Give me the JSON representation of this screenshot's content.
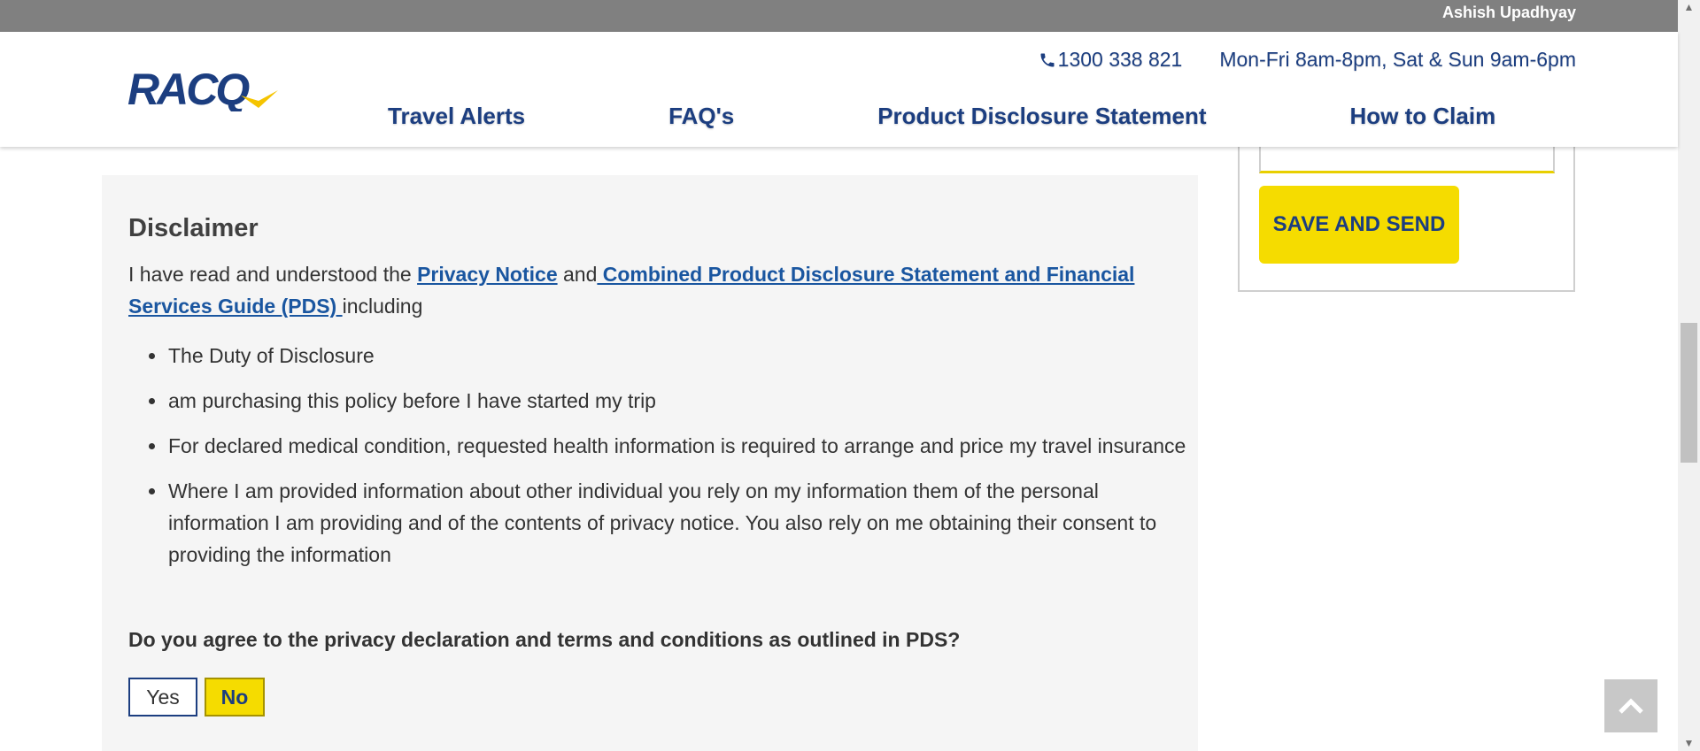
{
  "topbar": {
    "user_name": "Ashish Upadhyay"
  },
  "header": {
    "logo_text": "RACQ",
    "phone": "1300 338 821",
    "hours": "Mon-Fri 8am-8pm, Sat & Sun 9am-6pm",
    "nav": [
      "Travel Alerts",
      "FAQ's",
      "Product Disclosure Statement",
      "How to Claim"
    ]
  },
  "disclaimer": {
    "heading": "Disclaimer",
    "intro_prefix": "I have read and understood the ",
    "privacy_link": "Privacy Notice",
    "and_text": " and",
    "pds_link": " Combined Product Disclosure Statement and Financial Services Guide (PDS) ",
    "intro_suffix": "including",
    "bullets": [
      "The Duty of Disclosure",
      "am purchasing this policy before I have started my trip",
      "For declared medical condition, requested health information is required to arrange and price my travel insurance",
      "Where I am provided information about other individual you rely on my information them of the personal information I am providing and of the contents of privacy notice. You also rely on me obtaining their consent to providing the information"
    ],
    "question": "Do you agree to the privacy declaration and terms and conditions as outlined in PDS?",
    "options": {
      "yes": "Yes",
      "no": "No",
      "selected": "No"
    }
  },
  "sidebar": {
    "save_button": "SAVE AND SEND"
  },
  "colors": {
    "brand_blue": "#1c3e80",
    "brand_yellow": "#f5dc00",
    "link_blue": "#1a56a0"
  },
  "icons": {
    "phone": "phone-icon",
    "back_to_top": "chevron-up-icon"
  }
}
